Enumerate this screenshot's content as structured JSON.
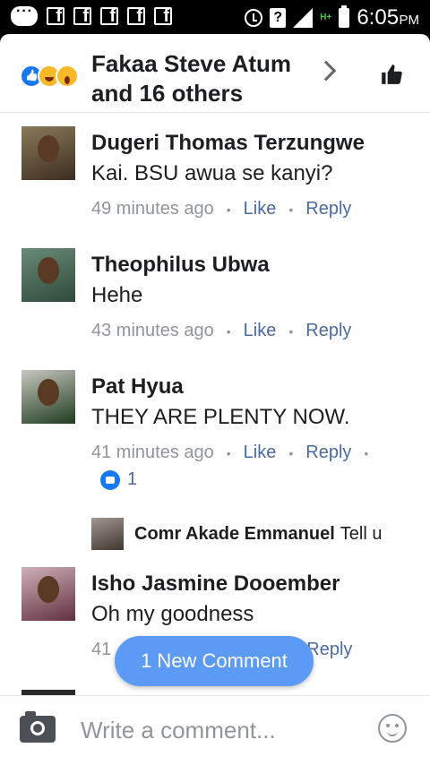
{
  "status_bar": {
    "time": "6:05",
    "ampm": "PM",
    "network": "H+"
  },
  "header": {
    "reactors_line1": "Fakaa Steve Atum",
    "reactors_line2": "and 16 others"
  },
  "comments": [
    {
      "name": "Dugeri Thomas Terzungwe",
      "text": "Kai. BSU awua se kanyi?",
      "time": "49 minutes ago",
      "like": "Like",
      "reply": "Reply"
    },
    {
      "name": "Theophilus Ubwa",
      "text": "Hehe",
      "time": "43 minutes ago",
      "like": "Like",
      "reply": "Reply"
    },
    {
      "name": "Pat Hyua",
      "text": "THEY ARE PLENTY NOW.",
      "time": "41 minutes ago",
      "like": "Like",
      "reply": "Reply",
      "likes_count": "1"
    },
    {
      "name": "Isho Jasmine Dooember",
      "text": "Oh my goodness",
      "time": "41",
      "reply": "Reply"
    }
  ],
  "reply_preview": {
    "name": "Comr Akade Emmanuel",
    "text": "Tell u"
  },
  "new_comment_button": "1 New Comment",
  "composer": {
    "placeholder": "Write a comment..."
  },
  "colors": {
    "accent": "#1877f2",
    "link": "#4b6aa1",
    "meta": "#90949c",
    "new_comment_bg": "#5b9af5"
  }
}
